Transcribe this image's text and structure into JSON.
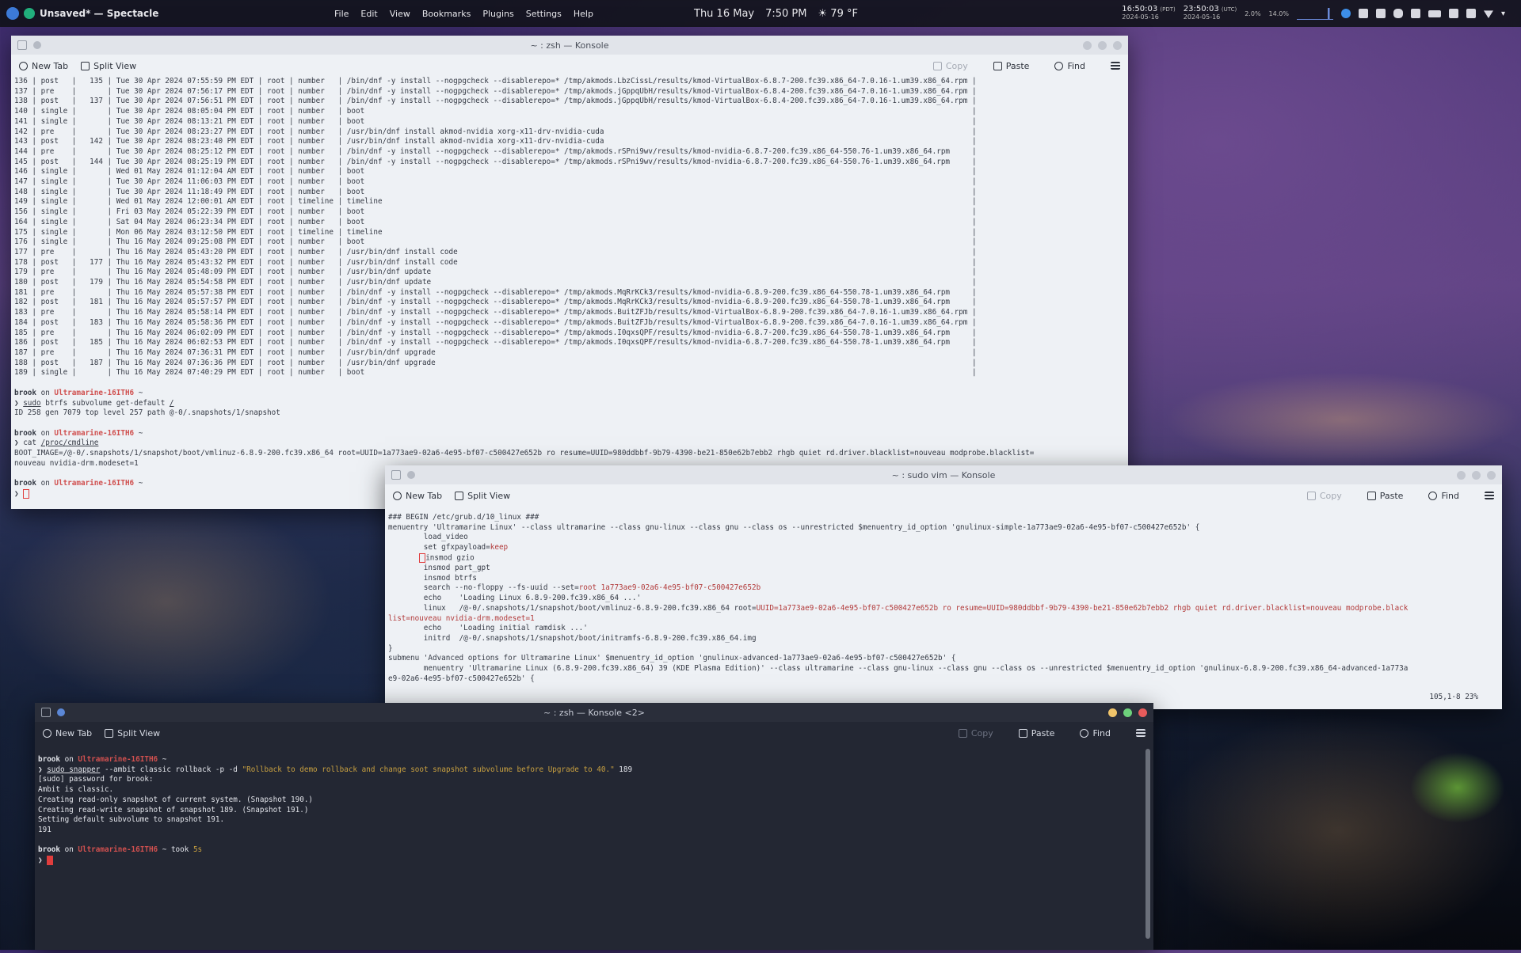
{
  "panel": {
    "app_title": "Unsaved* — Spectacle",
    "menu": [
      "File",
      "Edit",
      "View",
      "Bookmarks",
      "Plugins",
      "Settings",
      "Help"
    ],
    "date": "Thu 16 May",
    "time": "7:50 PM",
    "weather": "79 °F",
    "clock1": {
      "time": "16:50:03",
      "tz": "(PDT)",
      "date": "2024-05-16"
    },
    "clock2": {
      "time": "23:50:03",
      "tz": "(UTC)",
      "date": "2024-05-16"
    },
    "cpu": "2.0%",
    "mem": "14.0%"
  },
  "win1": {
    "title": "~ : zsh — Konsole",
    "toolbar": {
      "new_tab": "New Tab",
      "split_view": "Split View",
      "copy": "Copy",
      "paste": "Paste",
      "find": "Find"
    },
    "lines": [
      "136 | post   |   135 | Tue 30 Apr 2024 07:55:59 PM EDT | root | number   | /bin/dnf -y install --nogpgcheck --disablerepo=* /tmp/akmods.LbzCissL/results/kmod-VirtualBox-6.8.7-200.fc39.x86_64-7.0.16-1.um39.x86_64.rpm |",
      "137 | pre    |       | Tue 30 Apr 2024 07:56:17 PM EDT | root | number   | /bin/dnf -y install --nogpgcheck --disablerepo=* /tmp/akmods.jGppqUbH/results/kmod-VirtualBox-6.8.4-200.fc39.x86_64-7.0.16-1.um39.x86_64.rpm |",
      "138 | post   |   137 | Tue 30 Apr 2024 07:56:51 PM EDT | root | number   | /bin/dnf -y install --nogpgcheck --disablerepo=* /tmp/akmods.jGppqUbH/results/kmod-VirtualBox-6.8.4-200.fc39.x86_64-7.0.16-1.um39.x86_64.rpm |",
      "140 | single |       | Tue 30 Apr 2024 08:05:04 PM EDT | root | number   | boot                                                                                                                                         |",
      "141 | single |       | Tue 30 Apr 2024 08:13:21 PM EDT | root | number   | boot                                                                                                                                         |",
      "142 | pre    |       | Tue 30 Apr 2024 08:23:27 PM EDT | root | number   | /usr/bin/dnf install akmod-nvidia xorg-x11-drv-nvidia-cuda                                                                                   |",
      "143 | post   |   142 | Tue 30 Apr 2024 08:23:40 PM EDT | root | number   | /usr/bin/dnf install akmod-nvidia xorg-x11-drv-nvidia-cuda                                                                                   |",
      "144 | pre    |       | Tue 30 Apr 2024 08:25:12 PM EDT | root | number   | /bin/dnf -y install --nogpgcheck --disablerepo=* /tmp/akmods.rSPni9wv/results/kmod-nvidia-6.8.7-200.fc39.x86_64-550.76-1.um39.x86_64.rpm     |",
      "145 | post   |   144 | Tue 30 Apr 2024 08:25:19 PM EDT | root | number   | /bin/dnf -y install --nogpgcheck --disablerepo=* /tmp/akmods.rSPni9wv/results/kmod-nvidia-6.8.7-200.fc39.x86_64-550.76-1.um39.x86_64.rpm     |",
      "146 | single |       | Wed 01 May 2024 01:12:04 AM EDT | root | number   | boot                                                                                                                                         |",
      "147 | single |       | Tue 30 Apr 2024 11:06:03 PM EDT | root | number   | boot                                                                                                                                         |",
      "148 | single |       | Tue 30 Apr 2024 11:18:49 PM EDT | root | number   | boot                                                                                                                                         |",
      "149 | single |       | Wed 01 May 2024 12:00:01 AM EDT | root | timeline | timeline                                                                                                                                     |",
      "156 | single |       | Fri 03 May 2024 05:22:39 PM EDT | root | number   | boot                                                                                                                                         |",
      "164 | single |       | Sat 04 May 2024 06:23:34 PM EDT | root | number   | boot                                                                                                                                         |",
      "175 | single |       | Mon 06 May 2024 03:12:50 PM EDT | root | timeline | timeline                                                                                                                                     |",
      "176 | single |       | Thu 16 May 2024 09:25:08 PM EDT | root | number   | boot                                                                                                                                         |",
      "177 | pre    |       | Thu 16 May 2024 05:43:20 PM EDT | root | number   | /usr/bin/dnf install code                                                                                                                    |",
      "178 | post   |   177 | Thu 16 May 2024 05:43:32 PM EDT | root | number   | /usr/bin/dnf install code                                                                                                                    |",
      "179 | pre    |       | Thu 16 May 2024 05:48:09 PM EDT | root | number   | /usr/bin/dnf update                                                                                                                          |",
      "180 | post   |   179 | Thu 16 May 2024 05:54:58 PM EDT | root | number   | /usr/bin/dnf update                                                                                                                          |",
      "181 | pre    |       | Thu 16 May 2024 05:57:38 PM EDT | root | number   | /bin/dnf -y install --nogpgcheck --disablerepo=* /tmp/akmods.MqRrKCk3/results/kmod-nvidia-6.8.9-200.fc39.x86_64-550.78-1.um39.x86_64.rpm     |",
      "182 | post   |   181 | Thu 16 May 2024 05:57:57 PM EDT | root | number   | /bin/dnf -y install --nogpgcheck --disablerepo=* /tmp/akmods.MqRrKCk3/results/kmod-nvidia-6.8.9-200.fc39.x86_64-550.78-1.um39.x86_64.rpm     |",
      "183 | pre    |       | Thu 16 May 2024 05:58:14 PM EDT | root | number   | /bin/dnf -y install --nogpgcheck --disablerepo=* /tmp/akmods.BuitZFJb/results/kmod-VirtualBox-6.8.9-200.fc39.x86_64-7.0.16-1.um39.x86_64.rpm |",
      "184 | post   |   183 | Thu 16 May 2024 05:58:36 PM EDT | root | number   | /bin/dnf -y install --nogpgcheck --disablerepo=* /tmp/akmods.BuitZFJb/results/kmod-VirtualBox-6.8.9-200.fc39.x86_64-7.0.16-1.um39.x86_64.rpm |",
      "185 | pre    |       | Thu 16 May 2024 06:02:09 PM EDT | root | number   | /bin/dnf -y install --nogpgcheck --disablerepo=* /tmp/akmods.I0qxsQPF/results/kmod-nvidia-6.8.7-200.fc39.x86_64-550.78-1.um39.x86_64.rpm     |",
      "186 | post   |   185 | Thu 16 May 2024 06:02:53 PM EDT | root | number   | /bin/dnf -y install --nogpgcheck --disablerepo=* /tmp/akmods.I0qxsQPF/results/kmod-nvidia-6.8.7-200.fc39.x86_64-550.78-1.um39.x86_64.rpm     |",
      "187 | pre    |       | Thu 16 May 2024 07:36:31 PM EDT | root | number   | /usr/bin/dnf upgrade                                                                                                                         |",
      "188 | post   |   187 | Thu 16 May 2024 07:36:36 PM EDT | root | number   | /usr/bin/dnf upgrade                                                                                                                         |",
      "189 | single |       | Thu 16 May 2024 07:40:29 PM EDT | root | number   | boot                                                                                                                                         |"
    ],
    "prompt_user": "brook",
    "prompt_on": " on ",
    "prompt_host": "Ultramarine-16ITH6",
    "prompt_tilde": " ~",
    "cmd1_sudo": "sudo",
    "cmd1_rest": " btrfs subvolume get-default ",
    "cmd1_path": "/",
    "out1": "ID 258 gen 7079 top level 257 path @-0/.snapshots/1/snapshot",
    "cmd2_cat": " cat ",
    "cmd2_path": "/proc/cmdline",
    "out2a": "BOOT_IMAGE=/@-0/.snapshots/1/snapshot/boot/vmlinuz-6.8.9-200.fc39.x86_64 root=UUID=1a773ae9-02a6-4e95-bf07-c500427e652b ro resume=UUID=980ddbbf-9b79-4390-be21-850e62b7ebb2 rhgb quiet rd.driver.blacklist=nouveau modprobe.blacklist=",
    "out2b": "nouveau nvidia-drm.modeset=1"
  },
  "win2": {
    "title": "~ : sudo vim — Konsole",
    "toolbar": {
      "new_tab": "New Tab",
      "split_view": "Split View",
      "copy": "Copy",
      "paste": "Paste",
      "find": "Find"
    },
    "l1": "### BEGIN /etc/grub.d/10_linux ###",
    "l2": "menuentry 'Ultramarine Linux' --class ultramarine --class gnu-linux --class gnu --class os --unrestricted $menuentry_id_option 'gnulinux-simple-1a773ae9-02a6-4e95-bf07-c500427e652b' {",
    "l3": "        load_video",
    "l4a": "        set gfxpayload=",
    "l4b": "keep",
    "l5": "insmod gzio",
    "l6": "        insmod part_gpt",
    "l7": "        insmod btrfs",
    "l8a": "        search --no-floppy --fs-uuid --set=",
    "l8b": "root 1a773ae9-02a6-4e95-bf07-c500427e652b",
    "l9": "        echo    'Loading Linux 6.8.9-200.fc39.x86_64 ...'",
    "l10a": "        linux   /@-0/.snapshots/1/snapshot/boot/vmlinuz-6.8.9-200.fc39.x86_64 root=",
    "l10b": "UUID=1a773ae9-02a6-4e95-bf07-c500427e652b ro resume=UUID=980ddbbf-9b79-4390-be21-850e62b7ebb2 rhgb quiet rd.driver.blacklist=nouveau modprobe.black",
    "l11": "list=nouveau nvidia-drm.modeset=1",
    "l12": "        echo    'Loading initial ramdisk ...'",
    "l13": "        initrd  /@-0/.snapshots/1/snapshot/boot/initramfs-6.8.9-200.fc39.x86_64.img",
    "l14": "}",
    "l15": "submenu 'Advanced options for Ultramarine Linux' $menuentry_id_option 'gnulinux-advanced-1a773ae9-02a6-4e95-bf07-c500427e652b' {",
    "l16": "        menuentry 'Ultramarine Linux (6.8.9-200.fc39.x86_64) 39 (KDE Plasma Edition)' --class ultramarine --class gnu-linux --class gnu --class os --unrestricted $menuentry_id_option 'gnulinux-6.8.9-200.fc39.x86_64-advanced-1a773a",
    "l17": "e9-02a6-4e95-bf07-c500427e652b' {",
    "status_pos": "105,1-8",
    "status_pct": "23%"
  },
  "win3": {
    "title": "~ : zsh — Konsole <2>",
    "toolbar": {
      "new_tab": "New Tab",
      "split_view": "Split View",
      "copy": "Copy",
      "paste": "Paste",
      "find": "Find"
    },
    "cmd_sudo": "sudo",
    "cmd_snapper": " snapper",
    "cmd_rest": " --ambit classic rollback -p -d ",
    "cmd_str": "\"Rollback to demo rollback and change soot snapshot subvolume before Upgrade to 40.\"",
    "cmd_num": " 189",
    "out": [
      "[sudo] password for brook:",
      "Ambit is classic.",
      "Creating read-only snapshot of current system. (Snapshot 190.)",
      "Creating read-write snapshot of snapshot 189. (Snapshot 191.)",
      "Setting default subvolume to snapshot 191.",
      "191"
    ],
    "took": " took ",
    "took_val": "5s"
  }
}
